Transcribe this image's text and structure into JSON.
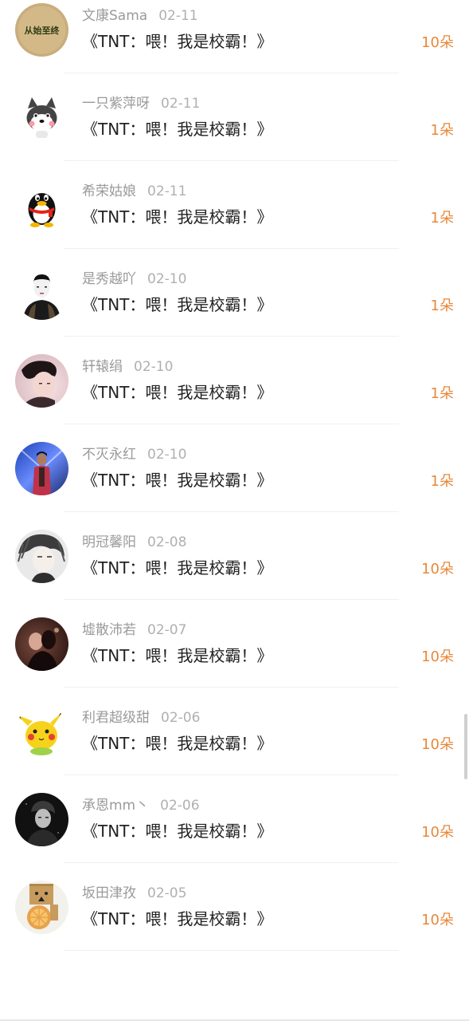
{
  "accent_color": "#e8883a",
  "gifts": [
    {
      "user": "文康Sama",
      "date": "02-11",
      "title": "《TNT：喂！我是校霸！》",
      "count": "10朵",
      "avatar": "logo-avatar",
      "avatar_text": "从始至终"
    },
    {
      "user": "一只紫萍呀",
      "date": "02-11",
      "title": "《TNT：喂！我是校霸！》",
      "count": "1朵",
      "avatar": "husky-cartoon-avatar"
    },
    {
      "user": "希荣姑娘",
      "date": "02-11",
      "title": "《TNT：喂！我是校霸！》",
      "count": "1朵",
      "avatar": "qq-penguin-avatar"
    },
    {
      "user": "是秀越吖",
      "date": "02-10",
      "title": "《TNT：喂！我是校霸！》",
      "count": "1朵",
      "avatar": "person-avatar"
    },
    {
      "user": "轩辕绢",
      "date": "02-10",
      "title": "《TNT：喂！我是校霸！》",
      "count": "1朵",
      "avatar": "photo-avatar"
    },
    {
      "user": "不灭永红",
      "date": "02-10",
      "title": "《TNT：喂！我是校霸！》",
      "count": "1朵",
      "avatar": "stage-photo-avatar"
    },
    {
      "user": "明冠馨阳",
      "date": "02-08",
      "title": "《TNT：喂！我是校霸！》",
      "count": "10朵",
      "avatar": "anime-avatar"
    },
    {
      "user": "墟散沛若",
      "date": "02-07",
      "title": "《TNT：喂！我是校霸！》",
      "count": "10朵",
      "avatar": "dark-photo-avatar"
    },
    {
      "user": "利君超级甜",
      "date": "02-06",
      "title": "《TNT：喂！我是校霸！》",
      "count": "10朵",
      "avatar": "pikachu-avatar"
    },
    {
      "user": "承恩mm丶",
      "date": "02-06",
      "title": "《TNT：喂！我是校霸！》",
      "count": "10朵",
      "avatar": "bw-photo-avatar"
    },
    {
      "user": "坂田津孜",
      "date": "02-05",
      "title": "《TNT：喂！我是校霸！》",
      "count": "10朵",
      "avatar": "danbo-avatar"
    }
  ]
}
